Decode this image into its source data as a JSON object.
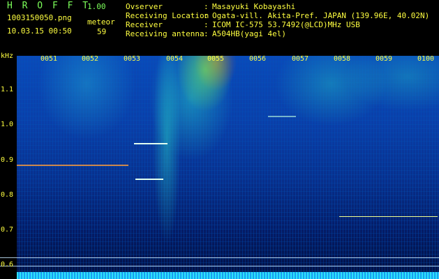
{
  "header": {
    "brand": "H R O F F T",
    "version": "1.00",
    "filename": "1003150050.png",
    "datetime": "10.03.15 00:50",
    "meteor_label": "meteor",
    "meteor_count": "59",
    "fields": [
      {
        "label": "Ovserver",
        "sep": ":",
        "value": "Masayuki Kobayashi"
      },
      {
        "label": "Receiving Location",
        "sep": ":",
        "value": "Ogata-vill. Akita-Pref. JAPAN (139.96E, 40.02N)"
      },
      {
        "label": "Receiver",
        "sep": ":",
        "value": "ICOM IC-575 53.7492(@LCD)MHz USB"
      },
      {
        "label": "Receiving antenna",
        "sep": ":",
        "value": "A504HB(yagi 4el)"
      }
    ]
  },
  "spectrogram": {
    "y_unit": "kHz",
    "y_ticks": [
      "1.1",
      "1.0",
      "0.9",
      "0.8",
      "0.7",
      "0.6"
    ],
    "x_ticks": [
      "0051",
      "0052",
      "0053",
      "0054",
      "0055",
      "0056",
      "0057",
      "0058",
      "0059",
      "0100"
    ],
    "colors": {
      "label": "#ffff40",
      "header_green": "#7cff5a",
      "background": "#000000",
      "base_blue": "#0a3fa8"
    }
  }
}
